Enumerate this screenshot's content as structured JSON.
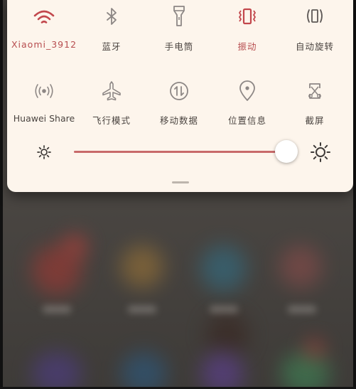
{
  "quick_settings": {
    "row1": [
      {
        "label": "Xiaomi_3912",
        "icon": "wifi-icon",
        "active": true
      },
      {
        "label": "蓝牙",
        "icon": "bluetooth-icon",
        "active": false
      },
      {
        "label": "手电筒",
        "icon": "flashlight-icon",
        "active": false
      },
      {
        "label": "振动",
        "icon": "vibrate-icon",
        "active": true
      },
      {
        "label": "自动旋转",
        "icon": "auto-rotate-icon",
        "active": false
      }
    ],
    "row2": [
      {
        "label": "Huawei Share",
        "icon": "huawei-share-icon",
        "active": false
      },
      {
        "label": "飞行模式",
        "icon": "airplane-icon",
        "active": false
      },
      {
        "label": "移动数据",
        "icon": "mobile-data-icon",
        "active": false
      },
      {
        "label": "位置信息",
        "icon": "location-icon",
        "active": false
      },
      {
        "label": "截屏",
        "icon": "screenshot-icon",
        "active": false
      }
    ]
  },
  "brightness": {
    "level": 0.97
  },
  "colors": {
    "active": "#b74d4f",
    "inactive": "#8a8380",
    "shade_background": "#fdf5ec"
  }
}
